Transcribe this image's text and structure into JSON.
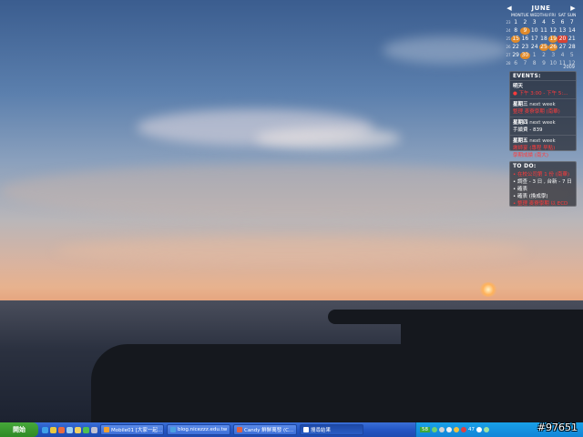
{
  "calendar": {
    "month": "JUNE",
    "year": "2009",
    "prev_icon": "chevron-left-icon",
    "next_icon": "chevron-right-icon",
    "weekdays": [
      "MON",
      "TUE",
      "WED",
      "THU",
      "FRI",
      "SAT",
      "SUN"
    ],
    "weeks": [
      {
        "wk": "23",
        "days": [
          "1",
          "2",
          "3",
          "4",
          "5",
          "6",
          "7"
        ]
      },
      {
        "wk": "24",
        "days": [
          "8",
          "9",
          "10",
          "11",
          "12",
          "13",
          "14"
        ]
      },
      {
        "wk": "25",
        "days": [
          "15",
          "16",
          "17",
          "18",
          "19",
          "20",
          "21"
        ]
      },
      {
        "wk": "26",
        "days": [
          "22",
          "23",
          "24",
          "25",
          "26",
          "27",
          "28"
        ]
      },
      {
        "wk": "27",
        "days": [
          "29",
          "30",
          "1",
          "2",
          "3",
          "4",
          "5"
        ]
      },
      {
        "wk": "28",
        "days": [
          "6",
          "7",
          "8",
          "9",
          "10",
          "11",
          "12"
        ]
      }
    ]
  },
  "events": {
    "title": "EVENTS:",
    "items": [
      {
        "day": "明天",
        "sub": "",
        "lines": [
          "● 下午 3:00 - 下午 5:..."
        ]
      },
      {
        "day": "星期三",
        "sub": "next week",
        "lines": [
          "整理 麥寮學期 (南華)"
        ]
      },
      {
        "day": "星期四",
        "sub": "next week",
        "lines": [
          "手續費 - 839"
        ]
      },
      {
        "day": "星期五",
        "sub": "next week",
        "lines": [
          "謝師宴 (專程 早點)",
          "學期成績 (南大)"
        ]
      }
    ]
  },
  "todo": {
    "title": "TO DO:",
    "items": [
      "• 在校公司第 1 份 (南華)",
      "• 調查 - 3 日 , 台新 - 7 日",
      "• 確表",
      "• 確表 (換成學)",
      "• 整理 麥寮學期 以 ECD"
    ]
  },
  "taskbar": {
    "start_label": "開始",
    "tasks": [
      {
        "label": "Mobile01 [大家一起...",
        "active": false
      },
      {
        "label": "blog.nicezzz.edu.tw",
        "active": false
      },
      {
        "label": "Candy 鮮鮮萬發 (C...",
        "active": false
      },
      {
        "label": "搜尋結果",
        "active": true
      }
    ],
    "tray_numbers": [
      "58",
      "47"
    ]
  },
  "watermark": "#97651",
  "colors": {
    "accent": "#d64234",
    "taskbar": "#2456c4",
    "tray": "#1185d8",
    "start": "#2f8a25"
  }
}
